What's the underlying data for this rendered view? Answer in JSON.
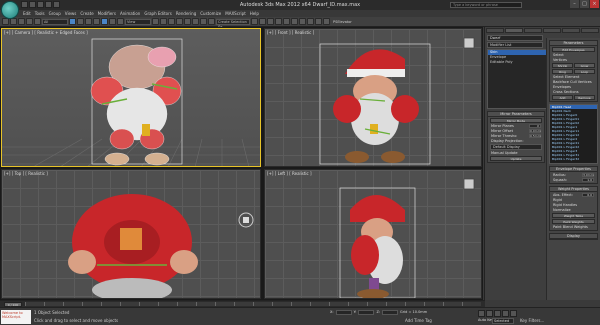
{
  "app": {
    "title": "Autodesk 3ds Max  2012 x64     Dwarf_ID.max.max",
    "search_placeholder": "Type a keyword or phrase"
  },
  "menu": [
    "Edit",
    "Tools",
    "Group",
    "Views",
    "Create",
    "Modifiers",
    "Animation",
    "Graph Editors",
    "Rendering",
    "Customize",
    "MAXScript",
    "Help"
  ],
  "toolbar": {
    "filter": "All",
    "view": "View",
    "selection_set": "Create Selection Se",
    "planar_label": "PSElevator"
  },
  "viewports": {
    "perspective": "[+] [ Camera ] [ Realistic + Edged Faces ]",
    "front": "[+] [ Front ] [ Realistic ]",
    "top": "[+] [ Top ] [ Realistic ]",
    "left": "[+] [ Left ] [ Realistic ]"
  },
  "command_panel": {
    "object_name": "Dwarf",
    "modifier_list": "Modifier List",
    "stack": [
      "Skin",
      "Envelope",
      "Editable Poly"
    ],
    "selected_stack": "Skin"
  },
  "mirror": {
    "rollout": "Mirror Parameters",
    "mirror_mode_label": "Mirror Mode",
    "mirror_mode": "X",
    "mirror_planes_label": "Mirror Planes",
    "mirror_planes": "X",
    "mirror_offset_label": "Mirror Offset",
    "mirror_offset": "0.0mm",
    "mirror_threshold_label": "Mirror Thresho",
    "mirror_threshold": "0.5mm",
    "projection_label": "Display Projection:",
    "projection": "Default Display",
    "manual_update": "Manual Update",
    "update": "Update"
  },
  "parameters": {
    "header": "Parameters",
    "edit_envelopes": "Edit Envelopes",
    "select_label": "Select",
    "vertices": "Vertices",
    "shrink": "Shrink",
    "grow": "Grow",
    "ring": "Ring",
    "loop": "Loop",
    "select_element": "Select Element",
    "backface_cull": "Backface Cull Vertices",
    "envelopes": "Envelopes",
    "cross_sections": "Cross Sections",
    "bones_label": "Bones:",
    "add": "Add",
    "remove": "Remove",
    "bones": [
      "Bip001 Head",
      "Bip001 Neck",
      "Bip001 L Finger0",
      "Bip001 L Finger01",
      "Bip001 L Finger02",
      "Bip001 L Finger1",
      "Bip001 L Finger11",
      "Bip001 L Finger12",
      "Bip001 L Finger2",
      "Bip001 L Finger21",
      "Bip001 L Finger22",
      "Bip001 L Finger3",
      "Bip001 L Finger31",
      "Bip001 L Finger32",
      "Bip001 R Finger0"
    ],
    "selected_bone": "Bip001 Head",
    "envelope_props": "Envelope Properties",
    "radius_label": "Radius:",
    "radius": "3.0mm",
    "squash_label": "Squash:",
    "squash": "1.0",
    "abs": "A",
    "rel": "R",
    "weight_props": "Weight Properties",
    "weight_label": "Abs. Effect:",
    "weight": "0.0",
    "rigid": "Rigid",
    "rigid_handles": "Rigid Handles",
    "normalize": "Normalize",
    "paint_weights": "Paint Weights",
    "weight_table": "Weight Table",
    "paint_blend": "Paint Blend Weights",
    "mirror": "Mirror",
    "display": "Display",
    "advanced": "Advanced Parameters",
    "gizmos": "Gizmos"
  },
  "timeline": {
    "frame": "0 / 100",
    "ticks": [
      "0",
      "10",
      "20",
      "30",
      "40",
      "50",
      "60",
      "70",
      "80",
      "90",
      "100"
    ]
  },
  "status": {
    "maxscript": "Welcome to MAXScript.",
    "selected": "1 Object Selected",
    "hint": "Click and drag to select and move objects",
    "x_label": "X:",
    "y_label": "Y:",
    "z_label": "Z:",
    "grid": "Grid = 10.0mm",
    "auto_key": "Auto Key",
    "selected_dropdown": "Selected",
    "set_key": "Set Key",
    "key_filters": "Key Filters...",
    "add_time_tag": "Add Time Tag"
  }
}
